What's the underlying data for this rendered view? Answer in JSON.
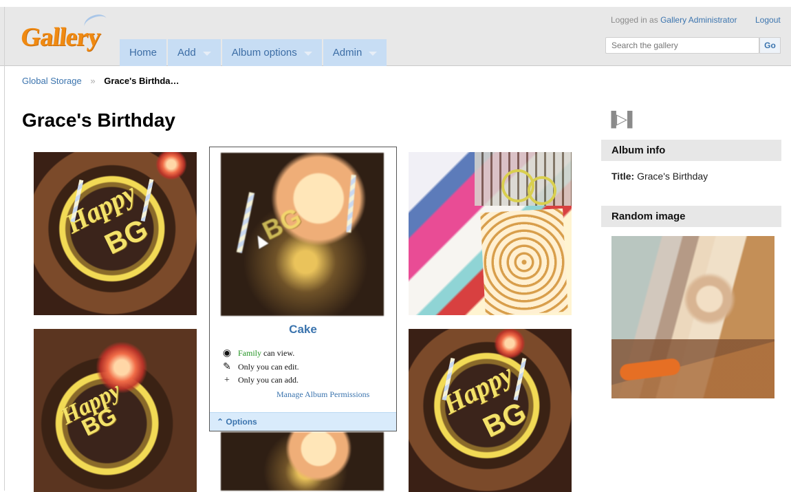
{
  "header": {
    "logo_text": "Gallery",
    "nav": [
      {
        "label": "Home",
        "dropdown": false
      },
      {
        "label": "Add",
        "dropdown": true
      },
      {
        "label": "Album options",
        "dropdown": true
      },
      {
        "label": "Admin",
        "dropdown": true
      }
    ],
    "user": {
      "prefix": "Logged in as",
      "name": "Gallery Administrator",
      "logout": "Logout"
    },
    "search": {
      "placeholder": "Search the gallery",
      "button": "Go"
    }
  },
  "breadcrumb": [
    "Global Storage",
    "Grace's Birthda…"
  ],
  "page": {
    "title": "Grace's Birthday",
    "items": [
      {
        "label": "Cake",
        "permissions": [
          "Family can view.",
          "Only you can edit.",
          "Only you can add."
        ],
        "manage": "Manage Album Permissions",
        "options": "Options"
      }
    ]
  },
  "sidebar": {
    "slideshow_icon": "slideshow-icon",
    "album_info_title": "Album info",
    "album_title_label": "Title:",
    "album_title_value": "Grace's Birthday",
    "random_image_title": "Random image"
  },
  "colors": {
    "accent": "#3b74ae",
    "nav_bg": "#c7ddf4",
    "permission_green": "#219321",
    "logo_orange": "#f08a12"
  }
}
